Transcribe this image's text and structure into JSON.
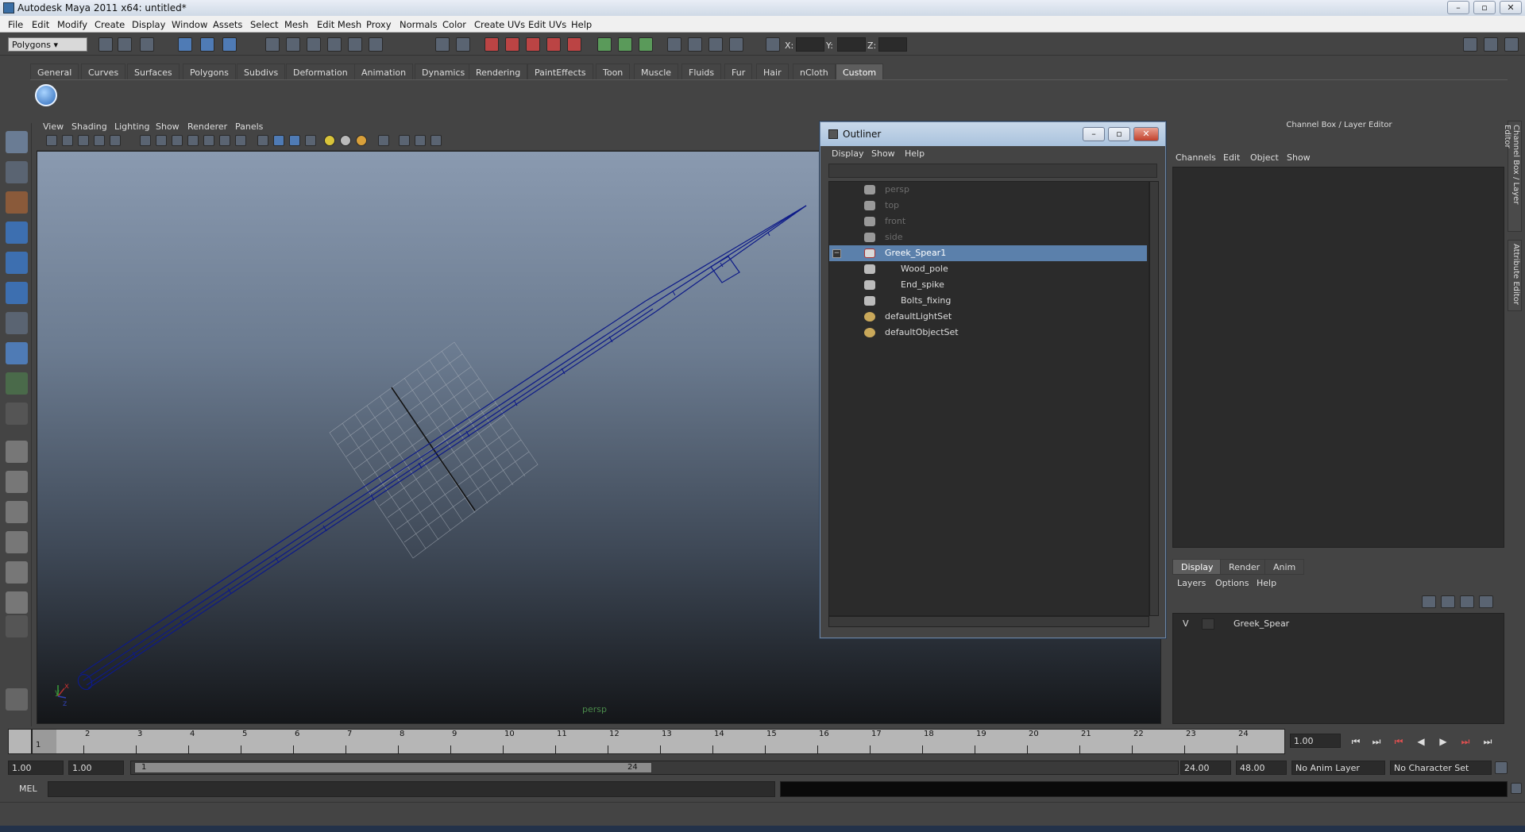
{
  "window": {
    "title": "Autodesk Maya 2011 x64: untitled*"
  },
  "menubar": [
    "File",
    "Edit",
    "Modify",
    "Create",
    "Display",
    "Window",
    "Assets",
    "Select",
    "Mesh",
    "Edit Mesh",
    "Proxy",
    "Normals",
    "Color",
    "Create UVs",
    "Edit UVs",
    "Help"
  ],
  "status_line": {
    "mode": "Polygons",
    "coord_labels": {
      "x": "X:",
      "y": "Y:",
      "z": "Z:"
    }
  },
  "shelf": {
    "tabs": [
      "General",
      "Curves",
      "Surfaces",
      "Polygons",
      "Subdivs",
      "Deformation",
      "Animation",
      "Dynamics",
      "Rendering",
      "PaintEffects",
      "Toon",
      "Muscle",
      "Fluids",
      "Fur",
      "Hair",
      "nCloth",
      "Custom"
    ],
    "active_tab": "Custom"
  },
  "viewport": {
    "menu": [
      "View",
      "Shading",
      "Lighting",
      "Show",
      "Renderer",
      "Panels"
    ],
    "camera_label": "persp",
    "axis": {
      "x": "x",
      "y": "y",
      "z": "z"
    }
  },
  "outliner": {
    "title": "Outliner",
    "menu": [
      "Display",
      "Show",
      "Help"
    ],
    "items": [
      {
        "label": "persp",
        "dim": true,
        "indent": 0
      },
      {
        "label": "top",
        "dim": true,
        "indent": 0
      },
      {
        "label": "front",
        "dim": true,
        "indent": 0
      },
      {
        "label": "side",
        "dim": true,
        "indent": 0
      },
      {
        "label": "Greek_Spear1",
        "selected": true,
        "expand": "−",
        "indent": 0
      },
      {
        "label": "Wood_pole",
        "indent": 1
      },
      {
        "label": "End_spike",
        "indent": 1
      },
      {
        "label": "Bolts_fixing",
        "indent": 1
      },
      {
        "label": "defaultLightSet",
        "indent": 0
      },
      {
        "label": "defaultObjectSet",
        "indent": 0
      }
    ]
  },
  "channel_box": {
    "title": "Channel Box / Layer Editor",
    "menu": [
      "Channels",
      "Edit",
      "Object",
      "Show"
    ],
    "side_tabs": [
      "Channel Box / Layer Editor",
      "Attribute Editor"
    ]
  },
  "layer_editor": {
    "tabs": [
      "Display",
      "Render",
      "Anim"
    ],
    "active_tab": "Display",
    "menu": [
      "Layers",
      "Options",
      "Help"
    ],
    "layers": [
      {
        "visible": "V",
        "name": "Greek_Spear"
      }
    ]
  },
  "time_slider": {
    "frames": [
      "1",
      "2",
      "3",
      "4",
      "5",
      "6",
      "7",
      "8",
      "9",
      "10",
      "11",
      "12",
      "13",
      "14",
      "15",
      "16",
      "17",
      "18",
      "19",
      "20",
      "21",
      "22",
      "23",
      "24"
    ],
    "current_frame_marker": "1",
    "current_time": "1.00",
    "playback_buttons": [
      "⏮",
      "⏭",
      "⏮",
      "◀",
      "▶",
      "⏭",
      "⏭"
    ]
  },
  "range_slider": {
    "start_time": "1.00",
    "playback_start": "1.00",
    "range_start_label": "1",
    "range_end_label": "24",
    "playback_end": "24.00",
    "end_time": "48.00",
    "anim_layer": "No Anim Layer",
    "character_set": "No Character Set"
  },
  "command_line": {
    "label": "MEL"
  },
  "colors": {
    "selection": "#5b80ab",
    "wireframe": "#0d1a88",
    "viewport_top": "#8a9ab0"
  }
}
